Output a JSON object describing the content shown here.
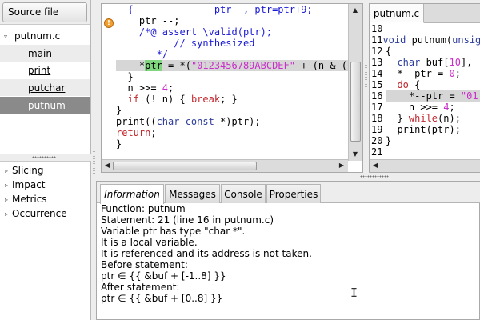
{
  "sidebar": {
    "header_button": "Source file",
    "file": {
      "name": "putnum.c",
      "expander": "▿"
    },
    "functions": [
      "main",
      "print",
      "putchar",
      "putnum"
    ],
    "selected_function": "putnum",
    "plugins": [
      {
        "label": "Slicing",
        "expander": "▹"
      },
      {
        "label": "Impact",
        "expander": "▹"
      },
      {
        "label": "Metrics",
        "expander": "▹"
      },
      {
        "label": "Occurrence",
        "expander": "▹"
      }
    ]
  },
  "code": {
    "warning_icon": "warning-icon"
  },
  "original_source": {
    "tab_label": "putnum.c",
    "lines": [
      {
        "num": "10",
        "text": ""
      },
      {
        "num": "11",
        "text": "void putnum(unsig"
      },
      {
        "num": "12",
        "text": "{"
      },
      {
        "num": "13",
        "text": "  char buf[10],"
      },
      {
        "num": "14",
        "text": "  *--ptr = 0;"
      },
      {
        "num": "15",
        "text": "  do {"
      },
      {
        "num": "16",
        "text": "    *--ptr = \"01"
      },
      {
        "num": "17",
        "text": "    n >>= 4;"
      },
      {
        "num": "18",
        "text": "  } while(n);"
      },
      {
        "num": "19",
        "text": "  print(ptr);"
      },
      {
        "num": "20",
        "text": "}"
      },
      {
        "num": "21",
        "text": ""
      }
    ]
  },
  "bottom_tabs": [
    "Information",
    "Messages",
    "Console",
    "Properties"
  ],
  "active_bottom_tab": "Information",
  "information": [
    "Function: putnum",
    "Statement: 21 (line 16 in putnum.c)",
    "Variable ptr has type \"char *\".",
    "It is a local variable.",
    "It is referenced and its address is not taken.",
    "Before statement:",
    "ptr ∈ {{ &buf + [-1..8] }}",
    "After statement:",
    "ptr ∈ {{ &buf + [0..8] }}"
  ],
  "colors": {
    "selected_row": "#8a8a8a",
    "comment": "#1a1ad6",
    "keyword": "#c1272d",
    "string": "#c92fc9",
    "var_highlight": "#7fd67f"
  }
}
